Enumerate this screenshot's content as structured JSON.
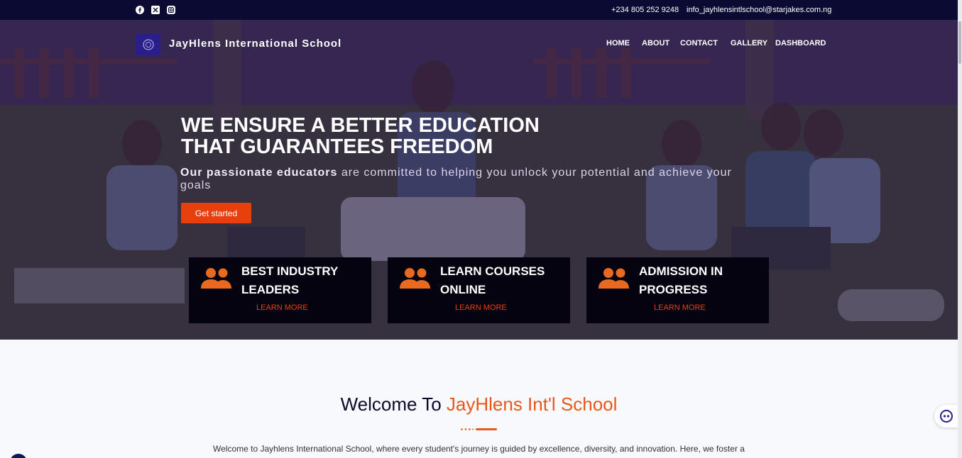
{
  "topbar": {
    "social": [
      {
        "icon": "facebook-icon"
      },
      {
        "icon": "x-twitter-icon"
      },
      {
        "icon": "instagram-icon"
      }
    ],
    "phone": "+234 805 252 9248",
    "email": "info_jayhlensintlschool@starjakes.com.ng"
  },
  "header": {
    "brand": "JayHlens International School",
    "nav": [
      "HOME",
      "ABOUT",
      "CONTACT",
      "GALLERY",
      "DASHBOARD"
    ]
  },
  "hero": {
    "headline_line1": "WE ENSURE A BETTER EDUCATION",
    "headline_line2": "THAT GUARANTEES FREEDOM",
    "sub_bold": "Our passionate educators",
    "sub_rest": " are committed to helping you unlock your potential and achieve your goals",
    "cta": "Get started"
  },
  "features": [
    {
      "title": "BEST INDUSTRY LEADERS",
      "link": "LEARN MORE",
      "icon": "users-icon"
    },
    {
      "title": "LEARN COURSES ONLINE",
      "link": "LEARN MORE",
      "icon": "users-icon"
    },
    {
      "title": "ADMISSION IN PROGRESS",
      "link": "LEARN MORE",
      "icon": "users-icon"
    }
  ],
  "welcome": {
    "title_prefix": "Welcome To ",
    "title_highlight": "JayHlens Int'l School",
    "text": "Welcome to Jayhlens International School, where every student's journey is guided by excellence, diversity, and innovation. Here, we foster a"
  },
  "colors": {
    "accent": "#e8400c",
    "highlight": "#e8581c",
    "topbar": "#0b0a33",
    "feature_bg": "#05030f"
  }
}
